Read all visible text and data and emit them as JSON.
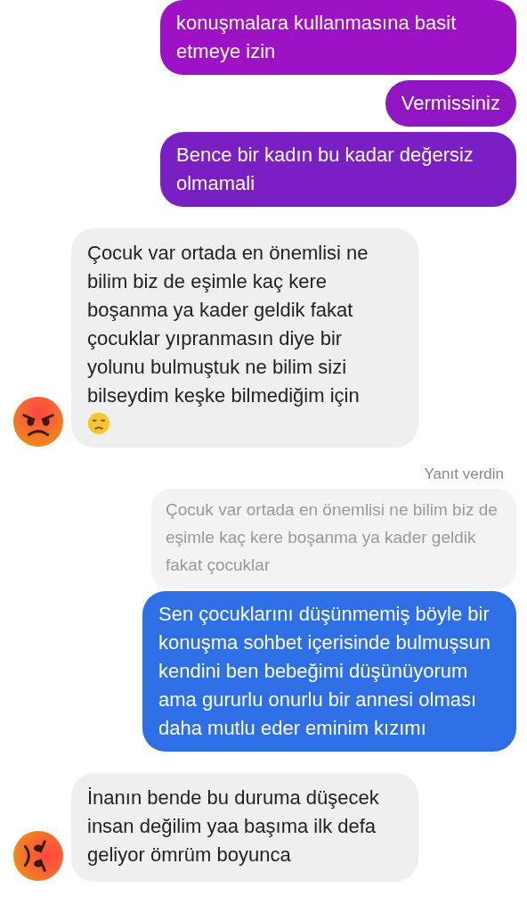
{
  "messages": [
    {
      "kind": "sent",
      "color": "#9c12c4",
      "text": "konuşmalara kullanmasına basit etmeye izin"
    },
    {
      "kind": "sent",
      "color": "#8f16c2",
      "text": "Vermissiniz"
    },
    {
      "kind": "sent",
      "color": "#7a1fc4",
      "text": "Bence bir kadın bu kadar değersiz olmamali"
    },
    {
      "kind": "received",
      "avatar_rotated": false,
      "emoji_end": true,
      "text": "Çocuk var ortada en önemlisi ne bilim biz de eşimle kaç kere boşanma ya kader geldik fakat çocuklar yıpranmasın diye bir yolunu bulmuştuk ne bilim sizi bilseydim keşke bilmediğim için"
    },
    {
      "kind": "reply",
      "label": "Yanıt verdin",
      "quote": "Çocuk var ortada en önemlisi  ne bilim biz de eşimle kaç kere boşanma ya kader geldik fakat çocuklar",
      "color": "#2f6fe6",
      "text": "Sen çocuklarını düşünmemiş böyle bir konuşma sohbet içerisinde bulmuşsun kendini ben bebeğimi düşünüyorum ama gururlu onurlu bir annesi olması daha mutlu eder eminim kızımı"
    },
    {
      "kind": "received",
      "avatar_rotated": true,
      "text": "İnanın bende bu duruma düşecek insan değilim yaa başıma ilk defa geliyor ömrüm boyunca"
    }
  ]
}
